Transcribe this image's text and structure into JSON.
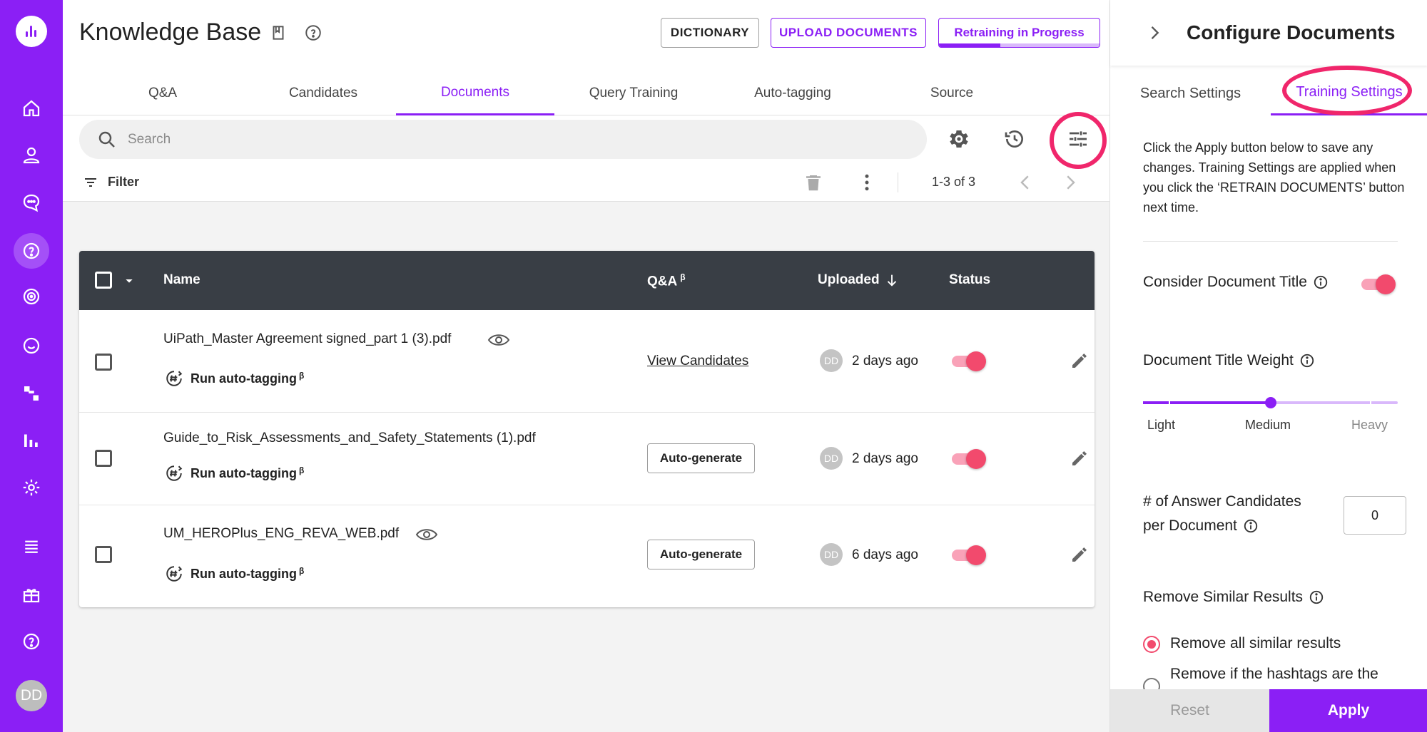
{
  "header": {
    "title": "Knowledge Base",
    "dictionary_label": "DICTIONARY",
    "upload_label": "UPLOAD DOCUMENTS",
    "retrain_label": "Retraining in Progress",
    "retrain_progress": 0.38
  },
  "tabs": [
    {
      "label": "Q&A",
      "active": false
    },
    {
      "label": "Candidates",
      "active": false
    },
    {
      "label": "Documents",
      "active": true
    },
    {
      "label": "Query Training",
      "active": false
    },
    {
      "label": "Auto-tagging",
      "active": false
    },
    {
      "label": "Source",
      "active": false
    }
  ],
  "search": {
    "placeholder": "Search",
    "value": ""
  },
  "toolbar": {
    "filter_label": "Filter",
    "range_label": "1-3 of 3"
  },
  "table": {
    "columns": {
      "name": "Name",
      "qa": "Q&A",
      "qa_sup": "β",
      "uploaded": "Uploaded",
      "status": "Status"
    },
    "rows": [
      {
        "name": "UiPath_Master Agreement signed_part 1 (3).pdf",
        "has_preview": true,
        "auto_tag": "Run auto-tagging",
        "auto_tag_sup": "β",
        "qa_action": "View Candidates",
        "qa_action_type": "link",
        "uploader": "DD",
        "uploaded": "2 days ago",
        "enabled": true
      },
      {
        "name": "Guide_to_Risk_Assessments_and_Safety_Statements (1).pdf",
        "has_preview": false,
        "auto_tag": "Run auto-tagging",
        "auto_tag_sup": "β",
        "qa_action": "Auto-generate",
        "qa_action_type": "button",
        "uploader": "DD",
        "uploaded": "2 days ago",
        "enabled": true
      },
      {
        "name": "UM_HEROPlus_ENG_REVA_WEB.pdf",
        "has_preview": true,
        "auto_tag": "Run auto-tagging",
        "auto_tag_sup": "β",
        "qa_action": "Auto-generate",
        "qa_action_type": "button",
        "uploader": "DD",
        "uploaded": "6 days ago",
        "enabled": true
      }
    ]
  },
  "panel": {
    "title": "Configure Documents",
    "tabs": [
      {
        "label": "Search Settings",
        "active": false
      },
      {
        "label": "Training Settings",
        "active": true
      }
    ],
    "description": "Click the Apply button below to save any changes. Training Settings are applied when you click the ‘RETRAIN DOCUMENTS’ button next time.",
    "consider_title_label": "Consider Document Title",
    "consider_title_on": true,
    "weight_label": "Document Title Weight",
    "weight_options": [
      "Light",
      "Medium",
      "Heavy"
    ],
    "weight_value": "Medium",
    "candidates_label_line1": "# of Answer Candidates",
    "candidates_label_line2": "per Document",
    "candidates_value": "0",
    "remove_similar_label": "Remove Similar Results",
    "remove_options": [
      {
        "label": "Remove all similar results",
        "selected": true
      },
      {
        "label": "Remove if the hashtags are the",
        "selected": false
      }
    ],
    "reset_label": "Reset",
    "apply_label": "Apply"
  },
  "user": {
    "initials": "DD"
  },
  "colors": {
    "accent": "#8b1ff5",
    "toggle": "#f24a6d",
    "highlight_ring": "#f0266b",
    "table_header": "#393e45"
  }
}
